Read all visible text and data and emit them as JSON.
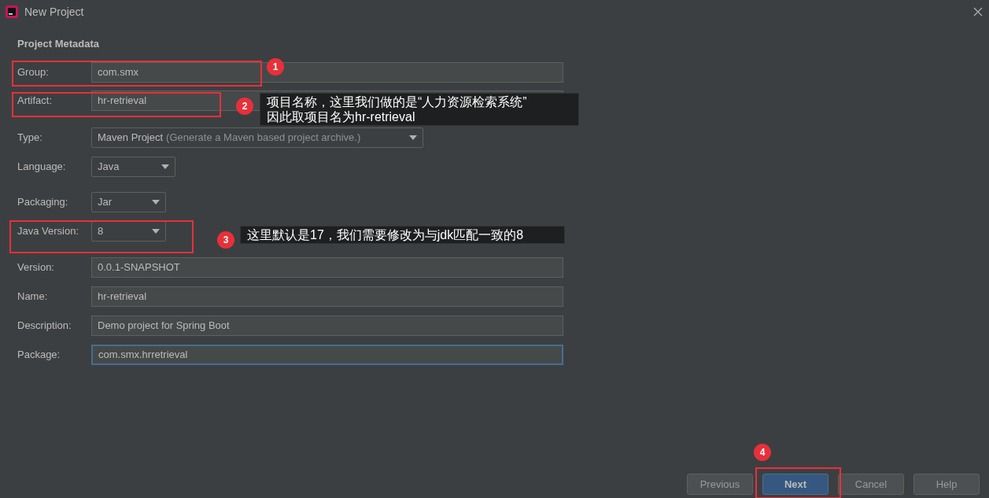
{
  "window": {
    "title": "New Project"
  },
  "section_title": "Project Metadata",
  "fields": [
    {
      "label": "Group:",
      "kind": "text",
      "value": "com.smx",
      "focused": false
    },
    {
      "label": "Artifact:",
      "kind": "text",
      "value": "hr-retrieval",
      "focused": false
    },
    {
      "label": "Type:",
      "kind": "dropdown",
      "value": "Maven Project",
      "hint": "(Generate a Maven based project archive.)"
    },
    {
      "label": "Language:",
      "kind": "dropdown",
      "value": "Java"
    },
    {
      "label": "Packaging:",
      "kind": "dropdown",
      "value": "Jar"
    },
    {
      "label": "Java Version:",
      "kind": "dropdown",
      "value": "8"
    },
    {
      "label": "Version:",
      "kind": "text",
      "value": "0.0.1-SNAPSHOT",
      "focused": false
    },
    {
      "label": "Name:",
      "kind": "text",
      "value": "hr-retrieval",
      "focused": false
    },
    {
      "label": "Description:",
      "kind": "text",
      "value": "Demo project for Spring Boot",
      "focused": false
    },
    {
      "label": "Package:",
      "kind": "text",
      "value": "com.smx.hrretrieval",
      "focused": true
    }
  ],
  "buttons": [
    {
      "label": "Previous",
      "default": false
    },
    {
      "label": "Next",
      "default": true
    },
    {
      "label": "Cancel",
      "default": false
    },
    {
      "label": "Help",
      "default": false
    }
  ],
  "annotations": [
    {
      "number": "1"
    },
    {
      "number": "2",
      "note": [
        "项目名称，这里我们做的是“人力资源检索系统”",
        "因此取项目名为hr-retrieval"
      ]
    },
    {
      "number": "3",
      "note": [
        "这里默认是17，我们需要修改为与jdk匹配一致的8"
      ]
    },
    {
      "number": "4"
    }
  ]
}
